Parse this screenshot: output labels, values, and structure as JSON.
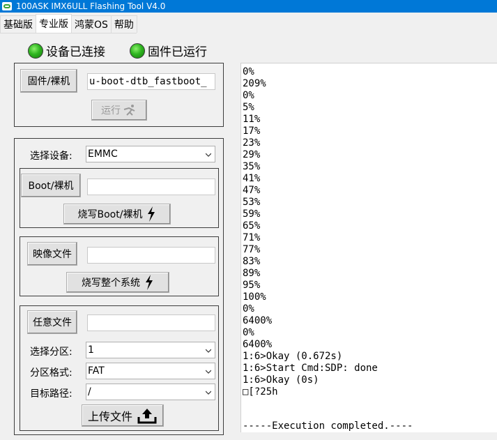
{
  "window": {
    "title": "100ASK IMX6ULL Flashing Tool V4.0"
  },
  "tabs": [
    {
      "label": "基础版",
      "active": false
    },
    {
      "label": "专业版",
      "active": true
    },
    {
      "label": "鸿蒙OS",
      "active": false
    },
    {
      "label": "帮助",
      "active": false
    }
  ],
  "status": {
    "device": "设备已连接",
    "firmware": "固件已运行"
  },
  "firmware_group": {
    "file_button": "固件/裸机",
    "file_value": "u-boot-dtb_fastboot_",
    "run_button": "运行"
  },
  "device_group": {
    "select_label": "选择设备:",
    "select_value": "EMMC",
    "boot": {
      "button": "Boot/裸机",
      "value": "",
      "burn_button": "烧写Boot/裸机"
    },
    "image": {
      "button": "映像文件",
      "value": "",
      "burn_button": "烧写整个系统"
    },
    "any": {
      "button": "任意文件",
      "value": "",
      "partition_label": "选择分区:",
      "partition_value": "1",
      "format_label": "分区格式:",
      "format_value": "FAT",
      "path_label": "目标路径:",
      "path_value": "/",
      "upload_button": "上传文件"
    }
  },
  "log": {
    "lines": [
      "0%",
      "209%",
      "0%",
      "5%",
      "11%",
      "17%",
      "23%",
      "29%",
      "35%",
      "41%",
      "47%",
      "53%",
      "59%",
      "65%",
      "71%",
      "77%",
      "83%",
      "89%",
      "95%",
      "100%",
      "0%",
      "6400%",
      "0%",
      "6400%",
      "1:6>Okay (0.672s)",
      "1:6>Start Cmd:SDP: done",
      "1:6>Okay (0s)",
      "□[?25h"
    ],
    "final": "-----Execution completed.----"
  },
  "colors": {
    "titlebar": "#0078d7",
    "led": "#2fb520"
  }
}
